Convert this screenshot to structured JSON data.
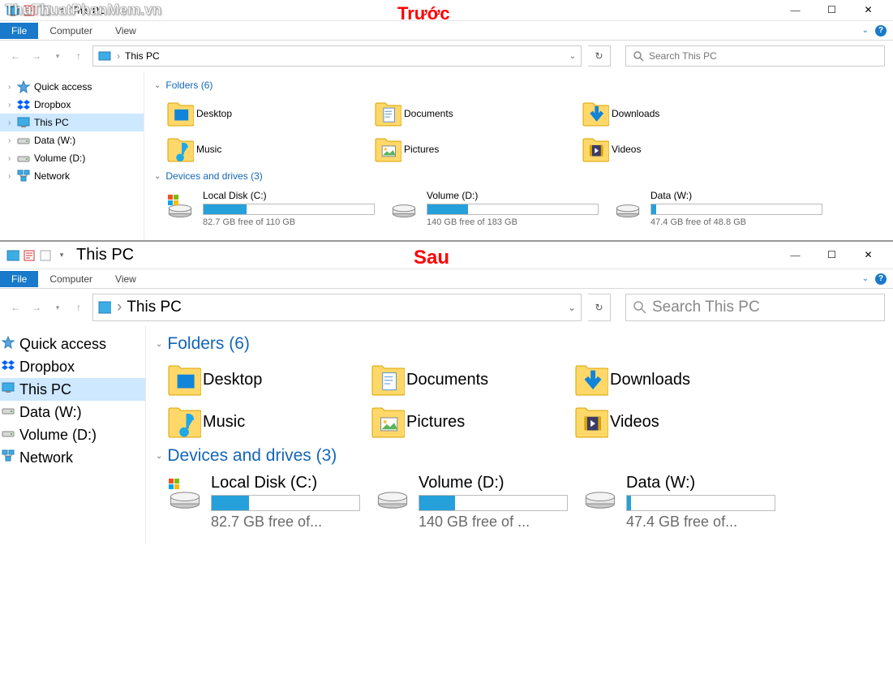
{
  "watermark": "ThuThuatPhanMem.vn",
  "labels": {
    "before": "Trước",
    "after": "Sau"
  },
  "top": {
    "title": "This PC",
    "file_tab": "File",
    "tabs": [
      "Computer",
      "View"
    ],
    "breadcrumb": "This PC",
    "search_placeholder": "Search This PC",
    "sidebar": [
      {
        "name": "Quick access",
        "icon": "star"
      },
      {
        "name": "Dropbox",
        "icon": "dropbox"
      },
      {
        "name": "This PC",
        "icon": "monitor",
        "selected": true
      },
      {
        "name": "Data (W:)",
        "icon": "drive"
      },
      {
        "name": "Volume (D:)",
        "icon": "drive"
      },
      {
        "name": "Network",
        "icon": "network"
      }
    ],
    "folders_header": "Folders (6)",
    "folders": [
      {
        "name": "Desktop",
        "icon": "desktop"
      },
      {
        "name": "Documents",
        "icon": "documents"
      },
      {
        "name": "Downloads",
        "icon": "downloads"
      },
      {
        "name": "Music",
        "icon": "music"
      },
      {
        "name": "Pictures",
        "icon": "pictures"
      },
      {
        "name": "Videos",
        "icon": "videos"
      }
    ],
    "drives_header": "Devices and drives (3)",
    "drives": [
      {
        "name": "Local Disk (C:)",
        "free": "82.7 GB free of 110 GB",
        "pct": 25,
        "system": true
      },
      {
        "name": "Volume (D:)",
        "free": "140 GB free of 183 GB",
        "pct": 24
      },
      {
        "name": "Data (W:)",
        "free": "47.4 GB free of 48.8 GB",
        "pct": 3
      }
    ]
  },
  "bottom": {
    "title": "This PC",
    "file_tab": "File",
    "tabs": [
      "Computer",
      "View"
    ],
    "breadcrumb": "This PC",
    "search_placeholder": "Search This PC",
    "sidebar": [
      {
        "name": "Quick access",
        "icon": "star"
      },
      {
        "name": "Dropbox",
        "icon": "dropbox"
      },
      {
        "name": "This PC",
        "icon": "monitor",
        "selected": true
      },
      {
        "name": "Data (W:)",
        "icon": "drive"
      },
      {
        "name": "Volume (D:)",
        "icon": "drive"
      },
      {
        "name": "Network",
        "icon": "network"
      }
    ],
    "folders_header": "Folders (6)",
    "folders": [
      {
        "name": "Desktop",
        "icon": "desktop"
      },
      {
        "name": "Documents",
        "icon": "documents"
      },
      {
        "name": "Downloads",
        "icon": "downloads"
      },
      {
        "name": "Music",
        "icon": "music"
      },
      {
        "name": "Pictures",
        "icon": "pictures"
      },
      {
        "name": "Videos",
        "icon": "videos"
      }
    ],
    "drives_header": "Devices and drives (3)",
    "drives": [
      {
        "name": "Local Disk (C:)",
        "free": "82.7 GB free of...",
        "pct": 25,
        "system": true
      },
      {
        "name": "Volume (D:)",
        "free": "140 GB free of ...",
        "pct": 24
      },
      {
        "name": "Data (W:)",
        "free": "47.4 GB free of...",
        "pct": 3
      }
    ]
  }
}
